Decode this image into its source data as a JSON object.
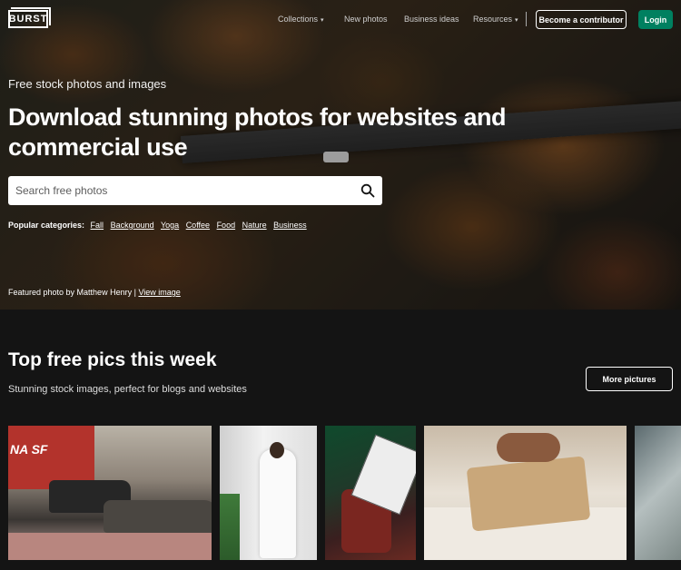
{
  "brand": {
    "logo_text": "BURST"
  },
  "nav": {
    "items": [
      {
        "label": "Collections",
        "has_caret": true
      },
      {
        "label": "New photos",
        "has_caret": false
      },
      {
        "label": "Business ideas",
        "has_caret": false
      },
      {
        "label": "Resources",
        "has_caret": true
      }
    ],
    "contributor_label": "Become a contributor",
    "login_label": "Login"
  },
  "hero": {
    "tagline": "Free stock photos and images",
    "headline": "Download stunning photos for websites and commercial use",
    "search_placeholder": "Search free photos",
    "categories_label": "Popular categories:",
    "categories": [
      "Fall",
      "Background",
      "Yoga",
      "Coffee",
      "Food",
      "Nature",
      "Business"
    ],
    "credit_text": "Featured photo by Matthew Henry",
    "credit_sep": "|",
    "credit_link": "View image"
  },
  "section": {
    "title": "Top free pics this week",
    "subtitle": "Stunning stock images, perfect for blogs and websites",
    "more_label": "More pictures"
  },
  "thumb1_sign": "NA SF",
  "colors": {
    "accent": "#008060",
    "background": "#141414",
    "text": "#ffffff"
  },
  "icons": {
    "search": "search-icon",
    "caret": "chevron-down-icon"
  }
}
